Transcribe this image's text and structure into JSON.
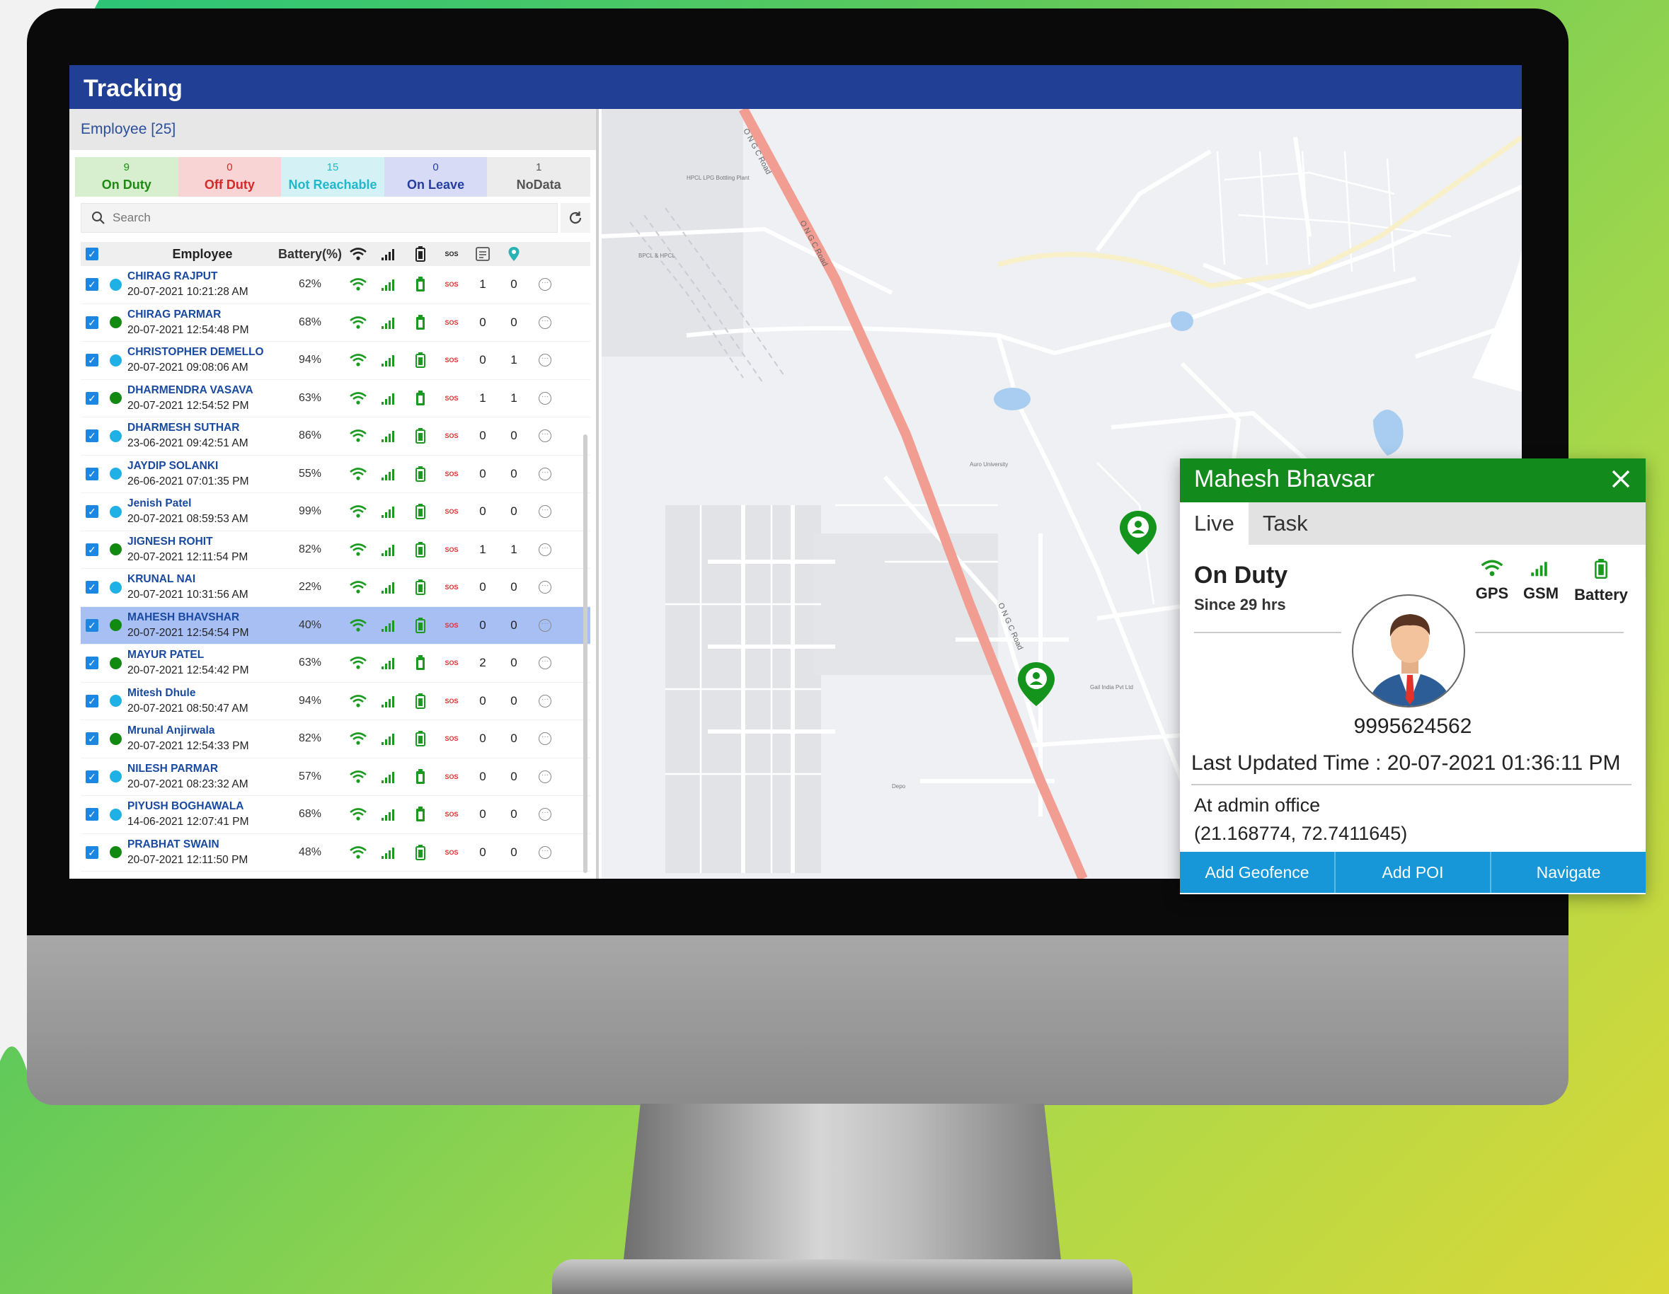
{
  "window": {
    "title": "Tracking"
  },
  "panel": {
    "employee_header": "Employee [25]",
    "statuses": [
      {
        "count": "9",
        "label": "On Duty"
      },
      {
        "count": "0",
        "label": "Off Duty"
      },
      {
        "count": "15",
        "label": "Not Reachable"
      },
      {
        "count": "0",
        "label": "On Leave"
      },
      {
        "count": "1",
        "label": "NoData"
      }
    ],
    "search_placeholder": "Search",
    "columns": {
      "employee": "Employee",
      "battery": "Battery(%)"
    },
    "sos_label": "SOS",
    "rows": [
      {
        "name": "CHIRAG RAJPUT",
        "time": "20-07-2021 10:21:28 AM",
        "battery": "62%",
        "count1": "1",
        "count2": "0"
      },
      {
        "name": "CHIRAG PARMAR",
        "time": "20-07-2021 12:54:48 PM",
        "battery": "68%",
        "count1": "0",
        "count2": "0"
      },
      {
        "name": "CHRISTOPHER DEMELLO",
        "time": "20-07-2021 09:08:06 AM",
        "battery": "94%",
        "count1": "0",
        "count2": "1"
      },
      {
        "name": "DHARMENDRA VASAVA",
        "time": "20-07-2021 12:54:52 PM",
        "battery": "63%",
        "count1": "1",
        "count2": "1"
      },
      {
        "name": "DHARMESH SUTHAR",
        "time": "23-06-2021 09:42:51 AM",
        "battery": "86%",
        "count1": "0",
        "count2": "0"
      },
      {
        "name": "JAYDIP SOLANKI",
        "time": "26-06-2021 07:01:35 PM",
        "battery": "55%",
        "count1": "0",
        "count2": "0"
      },
      {
        "name": "Jenish Patel",
        "time": "20-07-2021 08:59:53 AM",
        "battery": "99%",
        "count1": "0",
        "count2": "0"
      },
      {
        "name": "JIGNESH ROHIT",
        "time": "20-07-2021 12:11:54 PM",
        "battery": "82%",
        "count1": "1",
        "count2": "1"
      },
      {
        "name": "KRUNAL NAI",
        "time": "20-07-2021 10:31:56 AM",
        "battery": "22%",
        "count1": "0",
        "count2": "0"
      },
      {
        "name": "MAHESH BHAVSHAR",
        "time": "20-07-2021 12:54:54 PM",
        "battery": "40%",
        "count1": "0",
        "count2": "0"
      },
      {
        "name": "MAYUR PATEL",
        "time": "20-07-2021 12:54:42 PM",
        "battery": "63%",
        "count1": "2",
        "count2": "0"
      },
      {
        "name": "Mitesh Dhule",
        "time": "20-07-2021 08:50:47 AM",
        "battery": "94%",
        "count1": "0",
        "count2": "0"
      },
      {
        "name": "Mrunal Anjirwala",
        "time": "20-07-2021 12:54:33 PM",
        "battery": "82%",
        "count1": "0",
        "count2": "0"
      },
      {
        "name": "NILESH PARMAR",
        "time": "20-07-2021 08:23:32 AM",
        "battery": "57%",
        "count1": "0",
        "count2": "0"
      },
      {
        "name": "PIYUSH BOGHAWALA",
        "time": "14-06-2021 12:07:41 PM",
        "battery": "68%",
        "count1": "0",
        "count2": "0"
      },
      {
        "name": "PRABHAT SWAIN",
        "time": "20-07-2021 12:11:50 PM",
        "battery": "48%",
        "count1": "0",
        "count2": "0"
      }
    ]
  },
  "map": {
    "road_labels": [
      "O N G C Road",
      "O N G C Road",
      "O N G C Road"
    ],
    "place_labels": [
      "HPCL LPG Bottling Plant",
      "BPCL & HPCL",
      "Auro University",
      "Gail India Pvt Ltd",
      "Depo"
    ]
  },
  "popup": {
    "title": "Mahesh Bhavsar",
    "tabs": [
      "Live",
      "Task"
    ],
    "status": "On Duty",
    "since": "Since 29 hrs",
    "signals": [
      "GPS",
      "GSM",
      "Battery"
    ],
    "phone": "9995624562",
    "last_updated": "Last Updated Time : 20-07-2021 01:36:11 PM",
    "address": "At admin office",
    "coords": "(21.168774, 72.7411645)",
    "actions": [
      "Add Geofence",
      "Add POI",
      "Navigate"
    ]
  },
  "colors": {
    "header_blue": "#203f95",
    "popup_green": "#138a1c",
    "action_blue": "#1797d8",
    "dot_cyan": "#1fb1e6",
    "dot_green": "#128a12",
    "selected_row": "#a8bff4"
  },
  "icons": {
    "search": "search-icon",
    "refresh": "refresh-icon",
    "wifi": "wifi-icon",
    "signal": "signal-bars-icon",
    "battery": "battery-icon",
    "more": "more-options-icon",
    "close": "close-icon",
    "pin": "map-pin-icon"
  }
}
